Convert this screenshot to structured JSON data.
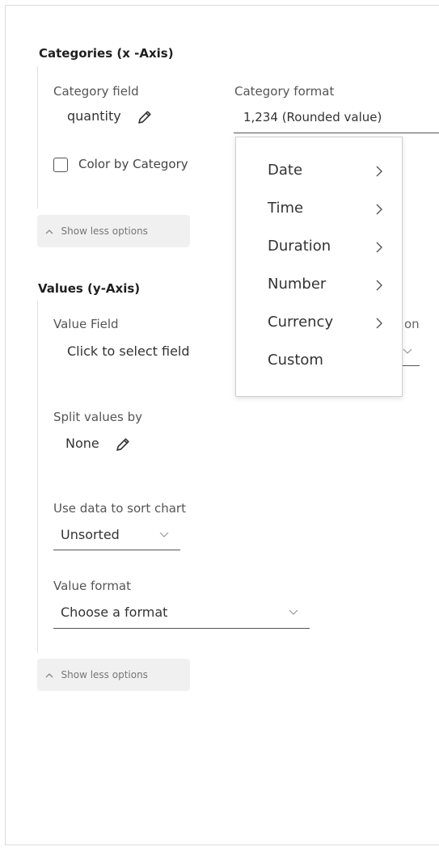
{
  "categories": {
    "title": "Categories (x -Axis)",
    "category_field_label": "Category field",
    "category_field_value": "quantity",
    "category_format_label": "Category format",
    "category_format_value": "1,234 (Rounded value)",
    "color_by_label": "Color by Category",
    "color_by_checked": false,
    "show_less_label": "Show less options"
  },
  "format_menu": {
    "items": [
      {
        "label": "Date",
        "has_submenu": true
      },
      {
        "label": "Time",
        "has_submenu": true
      },
      {
        "label": "Duration",
        "has_submenu": true
      },
      {
        "label": "Number",
        "has_submenu": true
      },
      {
        "label": "Currency",
        "has_submenu": true
      },
      {
        "label": "Custom",
        "has_submenu": false
      }
    ]
  },
  "values": {
    "title": "Values (y-Axis)",
    "value_field_label": "Value Field",
    "value_field_value": "Click to select field",
    "hidden_label_fragment": "on",
    "split_label": "Split values by",
    "split_value": "None",
    "sort_label": "Use data to sort chart",
    "sort_value": "Unsorted",
    "format_label": "Value format",
    "format_value": "Choose a format",
    "show_less_label": "Show less options"
  },
  "icons": {
    "pencil": "pencil-icon",
    "chevron_down": "chevron-down-icon",
    "chevron_up": "chevron-up-icon",
    "chevron_right": "chevron-right-icon"
  }
}
